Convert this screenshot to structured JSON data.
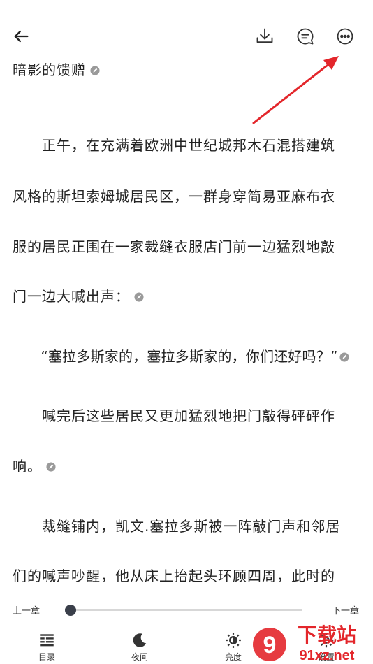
{
  "header": {
    "icons": [
      "back-arrow-icon",
      "download-icon",
      "comment-icon",
      "more-icon"
    ]
  },
  "content": {
    "lines": [
      "暗影的馈赠",
      "　　正午，在充满着欧洲中世纪城邦木石混搭建筑",
      "风格的斯坦索姆城居民区，一群身穿简易亚麻布衣",
      "服的居民正围在一家裁缝衣服店门前一边猛烈地敲",
      "门一边大喊出声：",
      "　　“塞拉多斯家的，塞拉多斯家的，你们还好吗？”",
      "　　喊完后这些居民又更加猛烈地把门敲得砰砰作",
      "响。",
      "　　裁缝铺内，凯文.塞拉多斯被一阵敲门声和邻居",
      "们的喊声吵醒，他从床上抬起头环顾四周，此时的"
    ]
  },
  "progress": {
    "prev_label": "上一章",
    "next_label": "下一章",
    "position_fraction": 0.01
  },
  "toolbar": {
    "tabs": [
      {
        "label": "目录",
        "icon": "catalog-icon"
      },
      {
        "label": "夜间",
        "icon": "moon-icon"
      },
      {
        "label": "亮度",
        "icon": "brightness-icon"
      },
      {
        "label": "设置",
        "icon": "settings-icon"
      }
    ]
  },
  "watermark": {
    "text": "下载站",
    "site": "91xz.net",
    "mark": "9"
  },
  "colors": {
    "accent_dark": "#3a3f4a",
    "annotation_red": "#e3262b"
  }
}
